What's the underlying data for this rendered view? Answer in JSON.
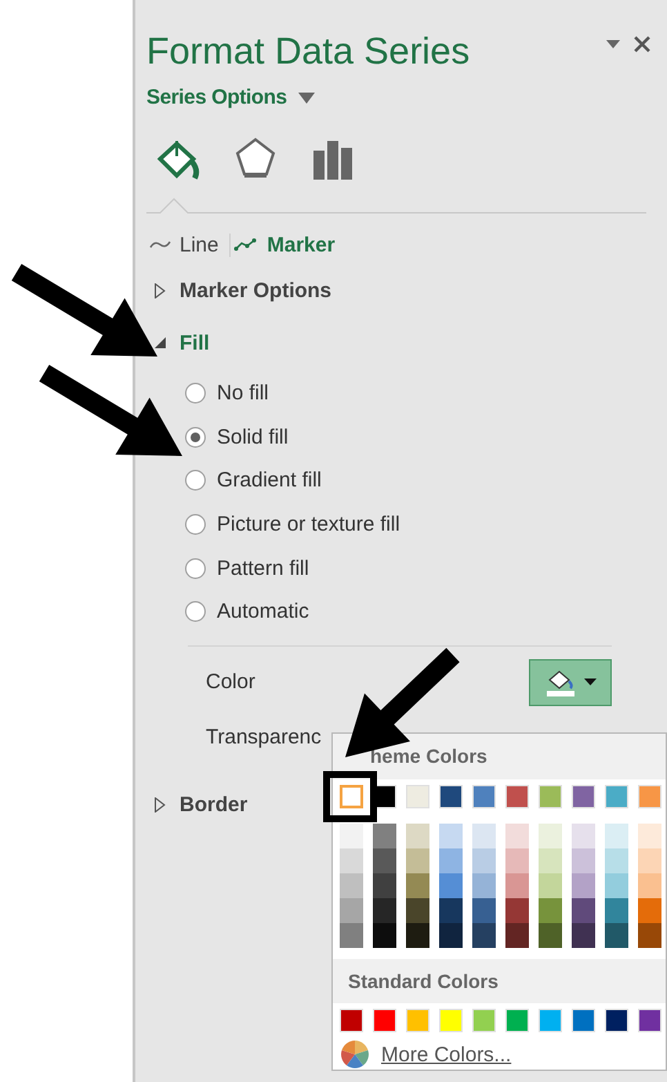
{
  "pane": {
    "title": "Format Data Series",
    "options_menu": "Series Options",
    "category_tabs": [
      {
        "kind": "fill",
        "selected": true
      },
      {
        "kind": "effects",
        "selected": false
      },
      {
        "kind": "series",
        "selected": false
      }
    ],
    "subtabs": [
      {
        "kind": "line",
        "label": "Line",
        "selected": false
      },
      {
        "kind": "marker",
        "label": "Marker",
        "selected": true
      }
    ],
    "sections": [
      {
        "title": "Marker Options",
        "expanded": false
      },
      {
        "title": "Fill",
        "expanded": true,
        "options": [
          {
            "label": "No fill",
            "selected": false
          },
          {
            "label": "Solid fill",
            "selected": true
          },
          {
            "label": "Gradient fill",
            "selected": false
          },
          {
            "label": "Picture or texture fill",
            "selected": false
          },
          {
            "label": "Pattern fill",
            "selected": false
          },
          {
            "label": "Automatic",
            "selected": false
          }
        ],
        "color_label": "Color",
        "transparency_label": "Transparenc"
      },
      {
        "title": "Border",
        "expanded": false
      }
    ]
  },
  "color_picker": {
    "theme_title": "heme Colors",
    "theme_colors": [
      {
        "color": "#ffffff",
        "selected": true,
        "shades": [
          {
            "color": "#f2f2f2"
          },
          {
            "color": "#d9d9d9"
          },
          {
            "color": "#bfbfbf"
          },
          {
            "color": "#a6a6a6"
          },
          {
            "color": "#808080"
          }
        ]
      },
      {
        "color": "#000000",
        "selected": false,
        "shades": [
          {
            "color": "#808080"
          },
          {
            "color": "#595959"
          },
          {
            "color": "#404040"
          },
          {
            "color": "#262626"
          },
          {
            "color": "#0d0d0d"
          }
        ]
      },
      {
        "color": "#eeece1",
        "selected": false,
        "shades": [
          {
            "color": "#ddd9c4"
          },
          {
            "color": "#c4bd97"
          },
          {
            "color": "#948a54"
          },
          {
            "color": "#4a452a"
          },
          {
            "color": "#1e1c11"
          }
        ]
      },
      {
        "color": "#1f497d",
        "selected": false,
        "shades": [
          {
            "color": "#c6d9f1"
          },
          {
            "color": "#8eb4e3"
          },
          {
            "color": "#558ed5"
          },
          {
            "color": "#17375e"
          },
          {
            "color": "#10243f"
          }
        ]
      },
      {
        "color": "#4f81bd",
        "selected": false,
        "shades": [
          {
            "color": "#dce6f2"
          },
          {
            "color": "#b9cde5"
          },
          {
            "color": "#95b3d7"
          },
          {
            "color": "#376092"
          },
          {
            "color": "#254061"
          }
        ]
      },
      {
        "color": "#c0504d",
        "selected": false,
        "shades": [
          {
            "color": "#f2dcdb"
          },
          {
            "color": "#e6b9b8"
          },
          {
            "color": "#d99694"
          },
          {
            "color": "#953735"
          },
          {
            "color": "#632523"
          }
        ]
      },
      {
        "color": "#9bbb59",
        "selected": false,
        "shades": [
          {
            "color": "#ebf1de"
          },
          {
            "color": "#d7e4bd"
          },
          {
            "color": "#c3d69b"
          },
          {
            "color": "#77933c"
          },
          {
            "color": "#4f6228"
          }
        ]
      },
      {
        "color": "#8064a2",
        "selected": false,
        "shades": [
          {
            "color": "#e6e0ec"
          },
          {
            "color": "#ccc1da"
          },
          {
            "color": "#b3a2c7"
          },
          {
            "color": "#604a7b"
          },
          {
            "color": "#403152"
          }
        ]
      },
      {
        "color": "#4bacc6",
        "selected": false,
        "shades": [
          {
            "color": "#dbeef4"
          },
          {
            "color": "#b7dee8"
          },
          {
            "color": "#93cddd"
          },
          {
            "color": "#31859c"
          },
          {
            "color": "#215968"
          }
        ]
      },
      {
        "color": "#f79646",
        "selected": false,
        "shades": [
          {
            "color": "#fdeada"
          },
          {
            "color": "#fcd5b5"
          },
          {
            "color": "#fac090"
          },
          {
            "color": "#e46c0a"
          },
          {
            "color": "#984807"
          }
        ]
      }
    ],
    "standard_title": "Standard Colors",
    "standard_colors": [
      {
        "color": "#c00000"
      },
      {
        "color": "#ff0000"
      },
      {
        "color": "#ffc000"
      },
      {
        "color": "#ffff00"
      },
      {
        "color": "#92d050"
      },
      {
        "color": "#00b050"
      },
      {
        "color": "#00b0f0"
      },
      {
        "color": "#0070c0"
      },
      {
        "color": "#002060"
      },
      {
        "color": "#7030a0"
      }
    ],
    "more_colors": "More Colors..."
  }
}
